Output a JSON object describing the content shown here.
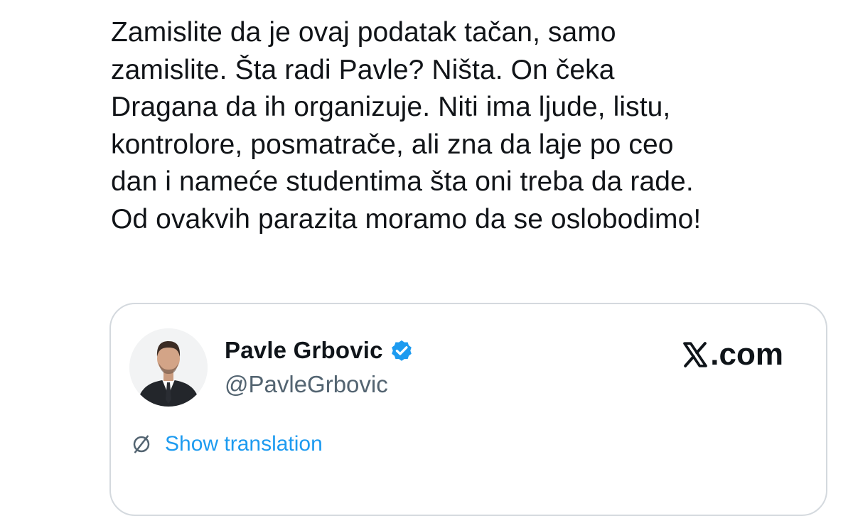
{
  "post": {
    "lines": [
      "Zamislite da je ovaj podatak tačan, samo",
      "zamislite. Šta radi Pavle? Ništa. On čeka",
      "Dragana da ih organizuje. Niti ima ljude, listu,",
      "kontrolore, posmatrače, ali zna da laje po ceo",
      "dan i nameće studentima šta oni treba da rade.",
      "Od ovakvih parazita moramo da se oslobodimo!"
    ]
  },
  "quoted": {
    "author_name": "Pavle Grbovic",
    "author_handle": "@PavleGrbovic",
    "verified": true,
    "brand_suffix": ".com",
    "translate_label": "Show translation",
    "accent_color": "#1d9bf0",
    "verified_color": "#1d9bf0",
    "icons": [
      "verified-badge-icon",
      "x-logo-icon",
      "globe-icon"
    ]
  }
}
